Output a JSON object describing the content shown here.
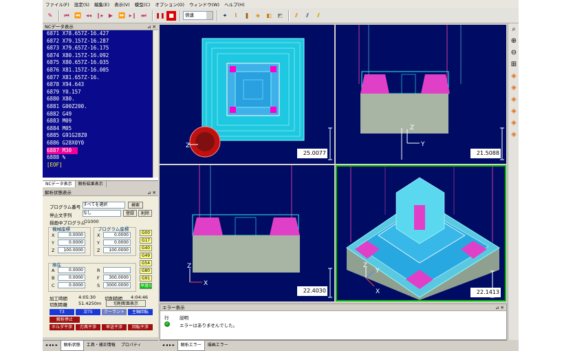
{
  "menu": [
    "ファイル(F)",
    "設定(S)",
    "編集(E)",
    "表示(V)",
    "模型(C)",
    "オプション(O)",
    "ウィンドウ(W)",
    "ヘルプ(H)"
  ],
  "toolbar": {
    "speed": "倍速"
  },
  "nc_panel": {
    "title": "NCデータ表示",
    "close": "⊿ ✕",
    "lines": [
      "6871 X78.657Z-16.427",
      "6872 X79.157Z-16.287",
      "6873 X79.657Z-16.175",
      "6874 X80.157Z-16.092",
      "6875 X80.657Z-16.035",
      "6876 X81.157Z-16.005",
      "6877 X81.657Z-16.",
      "6878 X94.643",
      "6879 Y0.157",
      "6880 X80.",
      "6881 G00Z200.",
      "6882 G49",
      "6883 M09",
      "6884 M05",
      "6885 G91G28Z0",
      "6886 G28X0Y0",
      "6887 M30",
      "6888 %"
    ],
    "eof": "[EOF]",
    "tabs": [
      "NCデータ表示",
      "解析結果表示"
    ]
  },
  "analysis": {
    "title": "解析状態表示",
    "close": "⊿ ✕",
    "prog_label": "プログラム番号",
    "prog_value": "すべてを選択",
    "search": "検索",
    "stop_label": "停止文字列",
    "stop_value": "なし",
    "register": "登録",
    "delete": "削除",
    "running_label": "描画中プログラム",
    "running_value": "O1000",
    "machine_label": "機械座標",
    "program_label": "プログラム座標",
    "mx": "0.0000",
    "my": "0.0000",
    "mz": "100.0000",
    "px": "0.0000",
    "py": "0.0000",
    "pz": "100.0000",
    "present_label": "現在",
    "a": "0.0000",
    "b": "0.0000",
    "c": "0.0000",
    "f": "300.0000",
    "s": "3000.0000",
    "axes": [
      "X",
      "Y",
      "Z"
    ],
    "axes2": [
      "A",
      "B",
      "C"
    ],
    "fs": [
      "R",
      "F",
      "S"
    ],
    "gcodes": [
      "G00",
      "G17",
      "G40",
      "G49",
      "G54",
      "G80",
      "G91",
      "早度0"
    ],
    "time_label": "加工時間",
    "time_value": "4:05:30",
    "cut_time_label": "切削時間",
    "cut_time_value": "4:04:46",
    "dist_label": "切削距離",
    "dist_value": "51.4250m",
    "section_btn": "切削断面表示",
    "t_btn": "T3",
    "next_btn": "次T5",
    "coolant_btn": "クーラント",
    "spindle_btn": "主軸回転",
    "analysis_stop": "解析停止",
    "holder_btn": "ホルダ干渉",
    "tool_btn": "刃具干渉",
    "fast_btn": "早送干渉",
    "rot_btn": "回転干渉"
  },
  "viewports": [
    {
      "readout": "25.0077"
    },
    {
      "readout": "21.5088"
    },
    {
      "readout": "22.4030"
    },
    {
      "readout": "22.1413"
    }
  ],
  "axis_labels": {
    "x": "X",
    "y": "Y",
    "z": "Z"
  },
  "error_panel": {
    "title": "エラー表示",
    "close": "⊿ ✕",
    "col_line": "行",
    "col_desc": "説明",
    "message": "エラーはありませんでした。"
  },
  "bottom_tabs_left": [
    "解析状態",
    "工具・補正情報",
    "プロパティ"
  ],
  "bottom_tabs_right": [
    "解析エラー",
    "描画エラー"
  ]
}
